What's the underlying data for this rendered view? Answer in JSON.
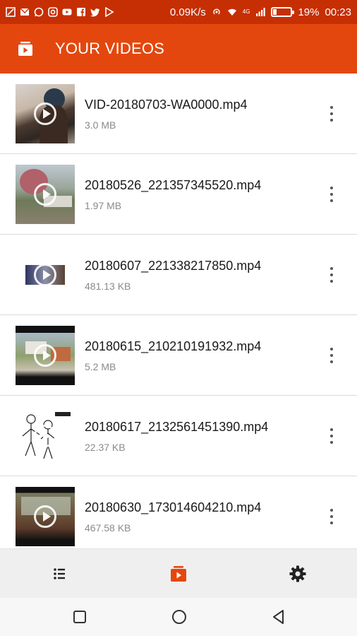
{
  "status_bar": {
    "speed": "0.09K/s",
    "network": "4G",
    "battery_percent": "19%",
    "battery_level": 0.19,
    "time": "00:23"
  },
  "app_bar": {
    "title": "YOUR VIDEOS",
    "background": "#e4470d"
  },
  "videos": [
    {
      "title": "VID-20180703-WA0000.mp4",
      "size": "3.0 MB"
    },
    {
      "title": "20180526_221357345520.mp4",
      "size": "1.97 MB"
    },
    {
      "title": "20180607_221338217850.mp4",
      "size": "481.13 KB"
    },
    {
      "title": "20180615_210210191932.mp4",
      "size": "5.2 MB"
    },
    {
      "title": "20180617_2132561451390.mp4",
      "size": "22.37 KB"
    },
    {
      "title": "20180630_173014604210.mp4",
      "size": "467.58 KB"
    }
  ],
  "bottom_nav": {
    "items": [
      "list-icon",
      "videos-icon",
      "settings-icon"
    ],
    "active": "videos-icon",
    "active_color": "#e4470d"
  },
  "system_nav": [
    "recent-apps-icon",
    "home-icon",
    "back-icon"
  ]
}
